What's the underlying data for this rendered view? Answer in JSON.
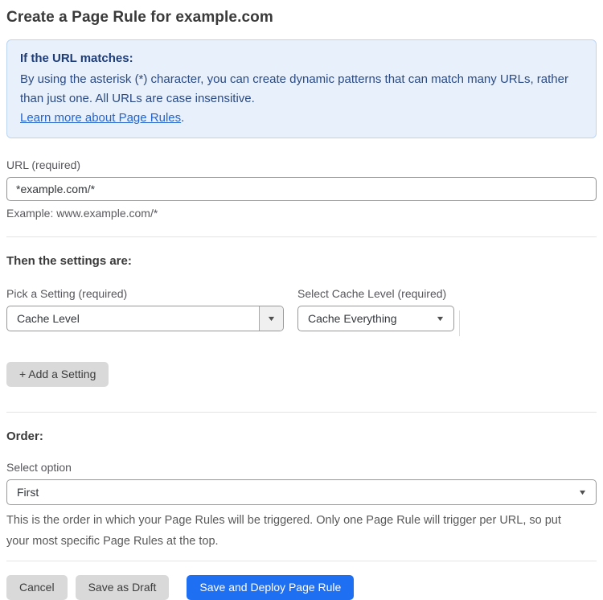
{
  "page": {
    "title": "Create a Page Rule for example.com"
  },
  "info": {
    "title": "If the URL matches:",
    "body": "By using the asterisk (*) character, you can create dynamic patterns that can match many URLs, rather than just one. All URLs are case insensitive.",
    "link_label": "Learn more about Page Rules",
    "link_suffix": "."
  },
  "url_field": {
    "label": "URL (required)",
    "value": "*example.com/*",
    "hint": "Example: www.example.com/*"
  },
  "settings": {
    "heading": "Then the settings are:",
    "picker": {
      "label": "Pick a Setting (required)",
      "value": "Cache Level"
    },
    "cache_level": {
      "label": "Select Cache Level (required)",
      "value": "Cache Everything"
    },
    "add_button_label": "+ Add a Setting"
  },
  "order": {
    "heading": "Order:",
    "select_label": "Select option",
    "select_value": "First",
    "hint": "This is the order in which your Page Rules will be triggered. Only one Page Rule will trigger per URL, so put your most specific Page Rules at the top."
  },
  "footer": {
    "cancel_label": "Cancel",
    "save_draft_label": "Save as Draft",
    "deploy_label": "Save and Deploy Page Rule"
  },
  "icons": {
    "chevron_down": "▼"
  },
  "colors": {
    "accent_blue": "#1f6ff2",
    "info_background": "#e8f1fb",
    "info_border": "#bcd4f3",
    "info_text": "#2a4a85",
    "link_blue": "#2563cf",
    "gray_button": "#d9d9d9"
  }
}
